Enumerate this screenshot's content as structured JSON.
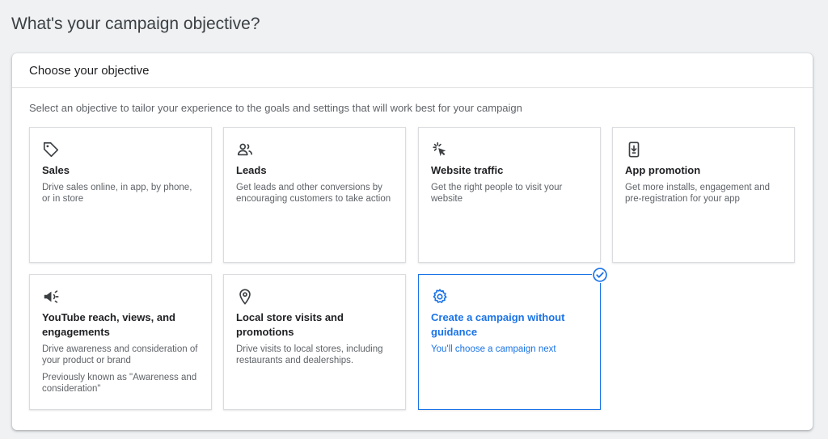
{
  "page": {
    "title": "What's your campaign objective?"
  },
  "panel": {
    "header": "Choose your objective",
    "instructions": "Select an objective to tailor your experience to the goals and settings that will work best for your campaign"
  },
  "objectives": [
    {
      "id": "sales",
      "icon": "tag-icon",
      "title": "Sales",
      "description": "Drive sales online, in app, by phone, or in store"
    },
    {
      "id": "leads",
      "icon": "people-icon",
      "title": "Leads",
      "description": "Get leads and other conversions by encouraging customers to take action"
    },
    {
      "id": "website-traffic",
      "icon": "cursor-click-icon",
      "title": "Website traffic",
      "description": "Get the right people to visit your website"
    },
    {
      "id": "app-promotion",
      "icon": "phone-download-icon",
      "title": "App promotion",
      "description": "Get more installs, engagement and pre-registration for your app"
    },
    {
      "id": "youtube-reach",
      "icon": "megaphone-icon",
      "title": "YouTube reach, views, and engagements",
      "description": "Drive awareness and consideration of your product or brand",
      "note": "Previously known as \"Awareness and consideration\""
    },
    {
      "id": "local-store",
      "icon": "location-pin-icon",
      "title": "Local store visits and promotions",
      "description": "Drive visits to local stores, including restaurants and dealerships."
    },
    {
      "id": "no-guidance",
      "icon": "gear-icon",
      "title": "Create a campaign without guidance",
      "description": "You'll choose a campaign next",
      "selected": true
    }
  ],
  "colors": {
    "accent": "#1a73e8",
    "background": "#eff1f3",
    "card_border": "#dadce0",
    "text_primary": "#202124",
    "text_secondary": "#5f6368"
  }
}
